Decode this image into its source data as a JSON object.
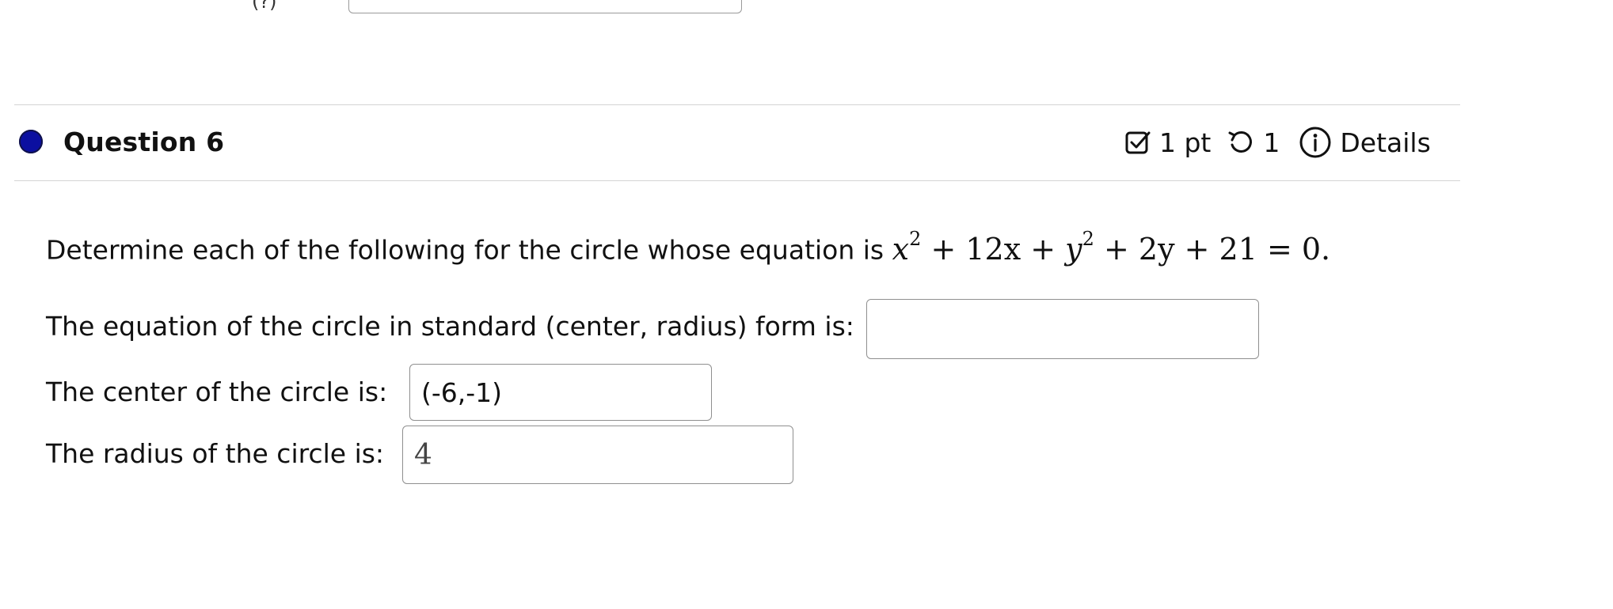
{
  "previous_question": {
    "label_fragment": "(?)"
  },
  "question": {
    "title": "Question 6",
    "status_color": "#0b0fa0",
    "points_label": "1 pt",
    "attempts_label": "1",
    "details_label": "Details"
  },
  "prompt": {
    "lead_text": "Determine each of the following for the circle whose equation is",
    "equation": {
      "x_term": "x",
      "x_exp": "2",
      "mid1": " + 12x + ",
      "y_term": "y",
      "y_exp": "2",
      "tail": " + 2y + 21 = 0."
    }
  },
  "fields": [
    {
      "label": "The equation of the circle in standard (center, radius) form is:",
      "value": ""
    },
    {
      "label": "The center of the circle is:",
      "value": "(-6,-1)"
    },
    {
      "label": "The radius of the circle is:",
      "value": "4"
    }
  ]
}
